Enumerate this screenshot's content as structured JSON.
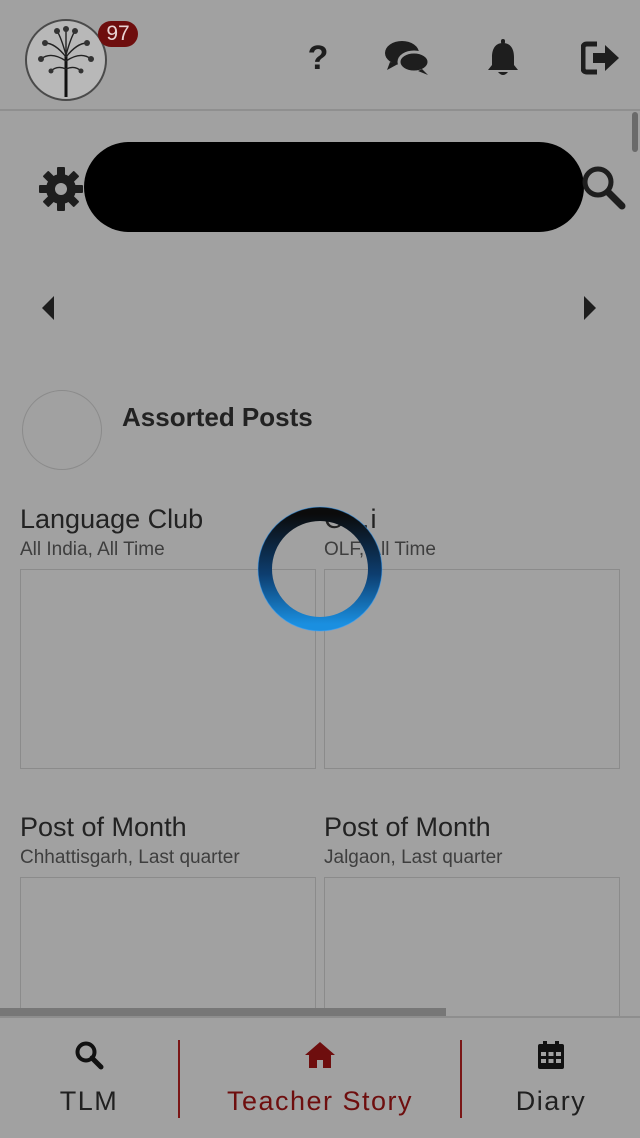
{
  "header": {
    "badge_count": "97",
    "icons": [
      "tree-logo",
      "help-icon",
      "chat-icon",
      "bell-icon",
      "logout-icon"
    ]
  },
  "toolbar": {
    "icons": [
      "gear-icon",
      "search-icon",
      "caret-left-icon",
      "caret-right-icon"
    ]
  },
  "section": {
    "title": "Assorted Posts"
  },
  "cards": [
    {
      "title": "Language Club",
      "subtitle": "All India, All Time"
    },
    {
      "title": "C…i",
      "subtitle": "OLF, All Time"
    },
    {
      "title": "Post of Month",
      "subtitle": "Chhattisgarh, Last quarter"
    },
    {
      "title": "Post of Month",
      "subtitle": "Jalgaon, Last quarter"
    }
  ],
  "bottom_nav": {
    "tlm": "TLM",
    "teacher_story": "Teacher Story",
    "diary": "Diary"
  },
  "colors": {
    "overlay_background": "#a1a1a1",
    "accent": "#6e0e0e",
    "spinner": "#1a8fe0"
  }
}
